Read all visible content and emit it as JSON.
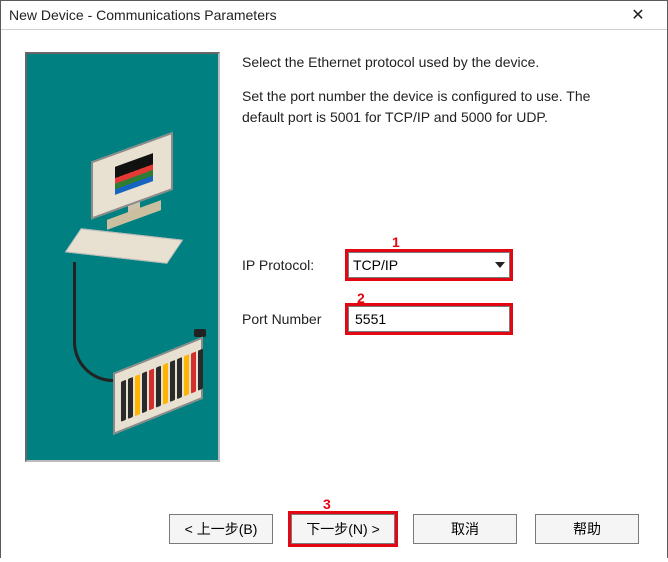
{
  "window": {
    "title": "New Device - Communications Parameters"
  },
  "help": {
    "p1": "Select the Ethernet protocol used by the device.",
    "p2": "Set the port number the device is configured to use. The default port is 5001 for TCP/IP and 5000 for UDP."
  },
  "form": {
    "ip_protocol_label": "IP Protocol:",
    "ip_protocol_value": "TCP/IP",
    "port_number_label": "Port Number",
    "port_number_value": "5551"
  },
  "annotations": {
    "n1": "1",
    "n2": "2",
    "n3": "3"
  },
  "buttons": {
    "back": "< 上一步(B)",
    "next": "下一步(N) >",
    "cancel": "取消",
    "help": "帮助"
  }
}
